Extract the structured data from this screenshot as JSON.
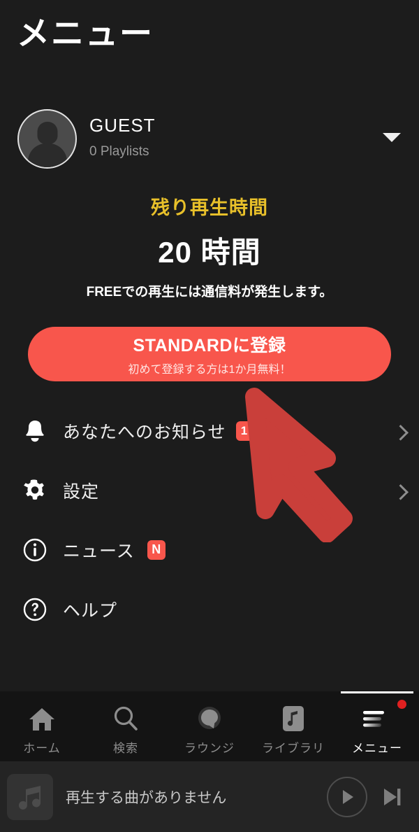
{
  "header": {
    "title": "メニュー"
  },
  "profile": {
    "name": "GUEST",
    "subtitle": "0 Playlists",
    "avatar_icon": "person-avatar-icon",
    "caret_icon": "chevron-down-icon"
  },
  "plan": {
    "label": "残り再生時間",
    "time": "20 時間",
    "note": "FREEでの再生には通信料が発生します。",
    "label_color": "#e8c02a"
  },
  "cta": {
    "main_label": "STANDARDに登録",
    "sub_label": "初めて登録する方は1か月無料！",
    "color": "#f8564c"
  },
  "menu": {
    "items": [
      {
        "label": "あなたへのお知らせ",
        "icon": "bell-icon",
        "badge": "1",
        "badge_type": "num",
        "chevron": true,
        "name": "notifications"
      },
      {
        "label": "設定",
        "icon": "gear-icon",
        "badge": "",
        "badge_type": "none",
        "chevron": true,
        "name": "settings"
      },
      {
        "label": "ニュース",
        "icon": "info-icon",
        "badge": "N",
        "badge_type": "n",
        "chevron": false,
        "name": "news"
      },
      {
        "label": "ヘルプ",
        "icon": "help-icon",
        "badge": "",
        "badge_type": "none",
        "chevron": false,
        "name": "help"
      }
    ],
    "badge_color": "#f8564c"
  },
  "pointer": {
    "icon": "arrow-cursor-overlay",
    "color": "#c93f3a"
  },
  "bottom_nav": {
    "items": [
      {
        "label": "ホーム",
        "icon": "home-icon",
        "active": false
      },
      {
        "label": "検索",
        "icon": "search-icon",
        "active": false
      },
      {
        "label": "ラウンジ",
        "icon": "lounge-icon",
        "active": false
      },
      {
        "label": "ライブラリ",
        "icon": "library-icon",
        "active": false
      },
      {
        "label": "メニュー",
        "icon": "menu-lines-icon",
        "active": true
      }
    ],
    "active_dot_color": "#e02020"
  },
  "mini_player": {
    "title": "再生する曲がありません",
    "thumb_icon": "music-note-icon",
    "play_icon": "play-icon",
    "next_icon": "skip-next-icon"
  }
}
